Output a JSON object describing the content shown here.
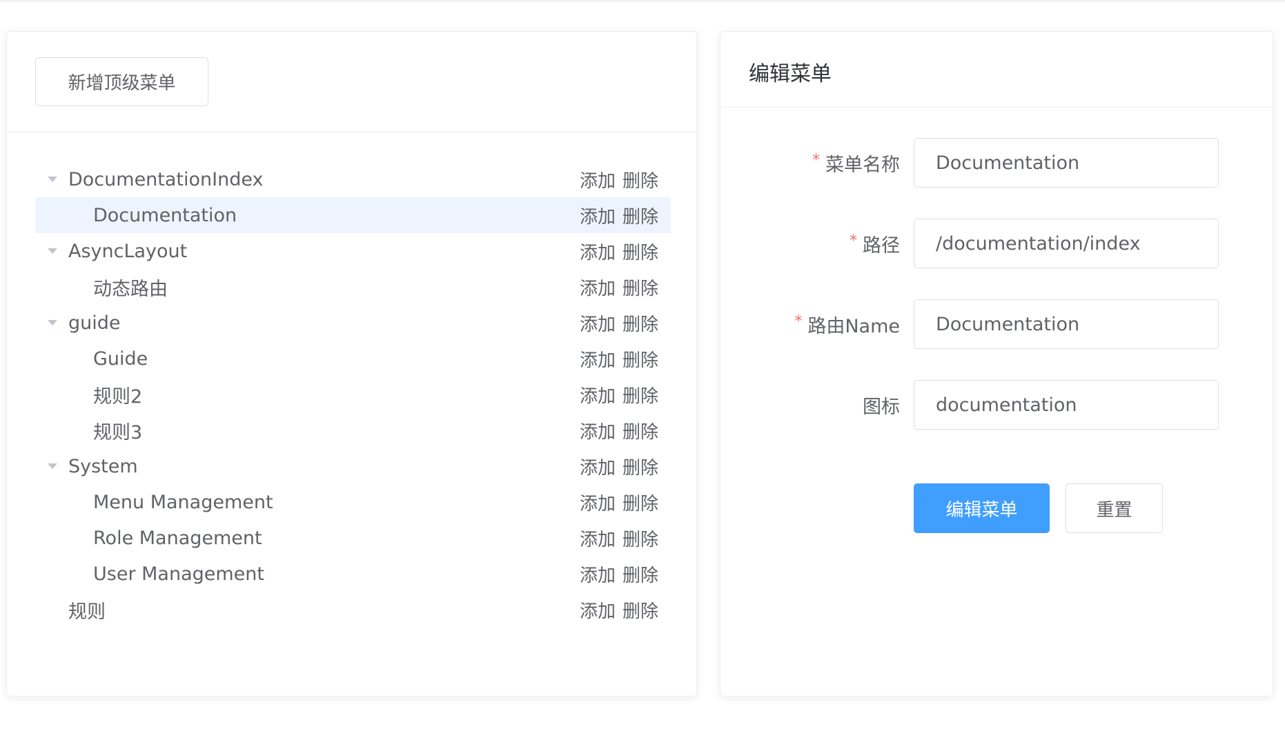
{
  "left_panel": {
    "add_top_menu_label": "新增顶级菜单",
    "tree": [
      {
        "label": "DocumentationIndex",
        "level": 0,
        "expandable": true,
        "selected": false
      },
      {
        "label": "Documentation",
        "level": 1,
        "expandable": false,
        "selected": true
      },
      {
        "label": "AsyncLayout",
        "level": 0,
        "expandable": true,
        "selected": false
      },
      {
        "label": "动态路由",
        "level": 1,
        "expandable": false,
        "selected": false
      },
      {
        "label": "guide",
        "level": 0,
        "expandable": true,
        "selected": false
      },
      {
        "label": "Guide",
        "level": 1,
        "expandable": false,
        "selected": false
      },
      {
        "label": "规则2",
        "level": 1,
        "expandable": false,
        "selected": false
      },
      {
        "label": "规则3",
        "level": 1,
        "expandable": false,
        "selected": false
      },
      {
        "label": "System",
        "level": 0,
        "expandable": true,
        "selected": false
      },
      {
        "label": "Menu Management",
        "level": 1,
        "expandable": false,
        "selected": false
      },
      {
        "label": "Role Management",
        "level": 1,
        "expandable": false,
        "selected": false
      },
      {
        "label": "User Management",
        "level": 1,
        "expandable": false,
        "selected": false
      },
      {
        "label": "规则",
        "level": 0,
        "expandable": false,
        "selected": false
      }
    ],
    "actions": {
      "add_label": "添加",
      "delete_label": "删除"
    }
  },
  "right_panel": {
    "title": "编辑菜单",
    "fields": {
      "menu_name": {
        "label": "菜单名称",
        "value": "Documentation",
        "required": true
      },
      "path": {
        "label": "路径",
        "value": "/documentation/index",
        "required": true
      },
      "route_name": {
        "label": "路由Name",
        "value": "Documentation",
        "required": true
      },
      "icon": {
        "label": "图标",
        "value": "documentation",
        "required": false
      }
    },
    "required_mark": "*",
    "submit_label": "编辑菜单",
    "reset_label": "重置"
  },
  "colors": {
    "primary": "#409eff",
    "required": "#f56c6c",
    "selected_row": "#eef4fd",
    "text": "#606266"
  }
}
